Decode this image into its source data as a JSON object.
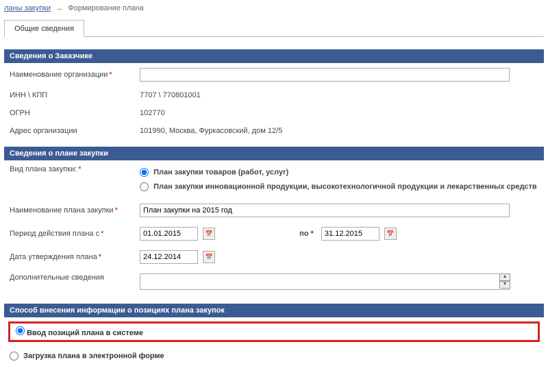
{
  "breadcrumb": {
    "link": "ланы закупки",
    "current": "Формирование плана"
  },
  "tab": "Общие сведения",
  "sections": {
    "customer": {
      "header": "Сведения о Заказчике",
      "org_name_label": "Наименование организации",
      "org_name_value": "",
      "inn_label": "ИНН \\ КПП",
      "inn_value": "7707         \\ 770801001",
      "ogrn_label": "ОГРН",
      "ogrn_value": "102770",
      "address_label": "Адрес организации",
      "address_value": "101990, Москва, Фуркасовский, дом 12/5"
    },
    "plan": {
      "header": "Сведения о плане закупки",
      "type_label": "Вид плана закупки:",
      "type_option1": "План закупки товаров (работ, услуг)",
      "type_option2": "План закупки инновационной продукции, высокотехнологичной продукции и лекарственных средств",
      "name_label": "Наименование плана закупки",
      "name_value": "План закупки на 2015 год",
      "period_from_label": "Период действия плана с",
      "period_from_value": "01.01.2015",
      "period_to_label": "по",
      "period_to_value": "31.12.2015",
      "approve_date_label": "Дата утверждения плана",
      "approve_date_value": "24.12.2014",
      "additional_label": "Дополнительные сведения",
      "additional_value": ""
    },
    "method": {
      "header": "Способ внесения информации о позициях плана закупок",
      "option1": "Ввод позиций плана в системе",
      "option2": "Загрузка плана в электронной форме"
    }
  }
}
